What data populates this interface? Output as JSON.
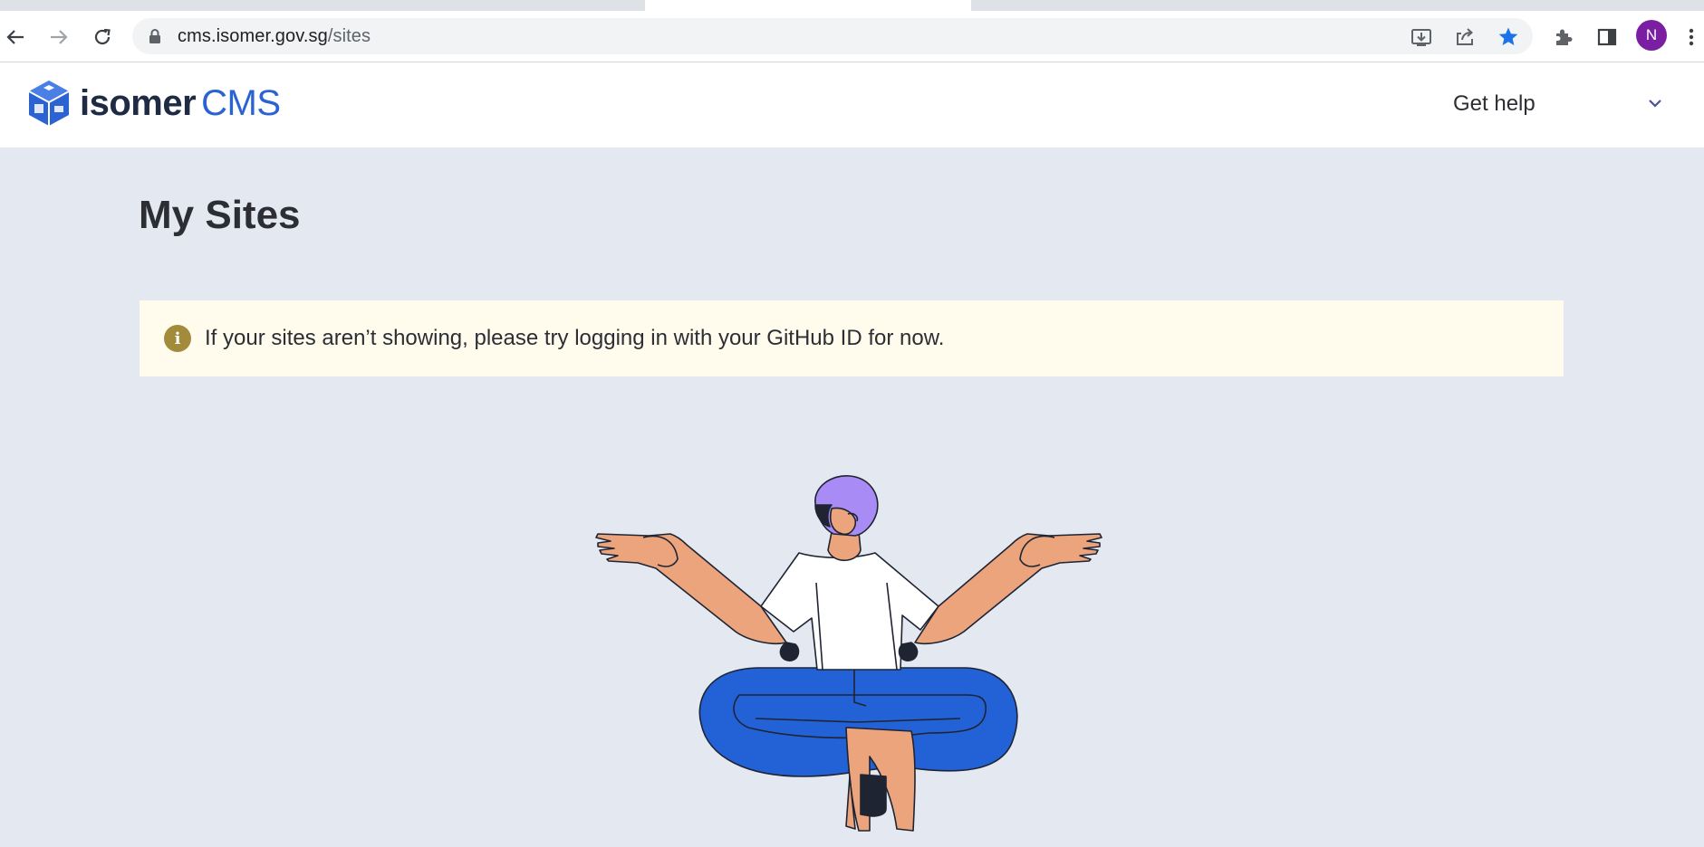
{
  "browser": {
    "url_host": "cms.isomer.gov.sg",
    "url_path": "/sites",
    "avatar_initial": "N",
    "icons": [
      "back-arrow-icon",
      "forward-arrow-icon",
      "reload-icon",
      "lock-icon",
      "download-icon",
      "share-icon",
      "star-icon",
      "extensions-puzzle-icon",
      "side-panel-icon",
      "kebab-menu-icon"
    ]
  },
  "header": {
    "logo_isomer": "isomer",
    "logo_cms": "CMS",
    "get_help": "Get help"
  },
  "main": {
    "title": "My Sites",
    "banner_text": "If your sites aren’t showing, please try logging in with your GitHub ID for now.",
    "banner_icon": "i"
  },
  "colors": {
    "brand_blue": "#2b63d3",
    "banner_bg": "#fffcee",
    "banner_icon": "#a38b3c",
    "page_bg": "#e3e8f1",
    "avatar": "#7b1fa2",
    "star": "#1a73e8"
  }
}
